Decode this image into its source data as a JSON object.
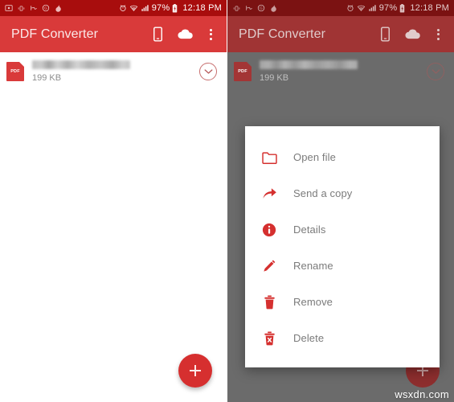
{
  "colors": {
    "brand_red": "#d93a3a",
    "status_bar_red": "#a80d0d",
    "fab_red": "#d62f2f",
    "menu_label_gray": "#7b7b7b",
    "scrim": "#6b6b6b"
  },
  "status_bar": {
    "battery_percent": "97%",
    "time": "12:18 PM",
    "icons": [
      "screenshot-icon",
      "vibrate-icon",
      "do-not-disturb-icon",
      "sync-icon",
      "app-notification-icon"
    ],
    "right_icons": [
      "alarm-icon",
      "wifi-icon",
      "signal-icon",
      "battery-icon"
    ]
  },
  "app_bar": {
    "title": "PDF Converter",
    "actions": [
      "phone-icon",
      "cloud-icon",
      "overflow-menu-icon"
    ]
  },
  "file_list": {
    "items": [
      {
        "name": "",
        "name_redacted": true,
        "size": "199 KB",
        "type_badge": "PDF",
        "expand_icon": "chevron-down-circle-icon"
      }
    ]
  },
  "fab": {
    "label": "+",
    "icon": "plus-icon"
  },
  "context_menu": {
    "items": [
      {
        "label": "Open file",
        "icon": "folder-icon"
      },
      {
        "label": "Send a copy",
        "icon": "share-arrow-icon"
      },
      {
        "label": "Details",
        "icon": "info-circle-icon"
      },
      {
        "label": "Rename",
        "icon": "pencil-icon"
      },
      {
        "label": "Remove",
        "icon": "trash-icon"
      },
      {
        "label": "Delete",
        "icon": "trash-x-icon"
      }
    ]
  },
  "watermark": {
    "text": "wsxdn.com"
  }
}
